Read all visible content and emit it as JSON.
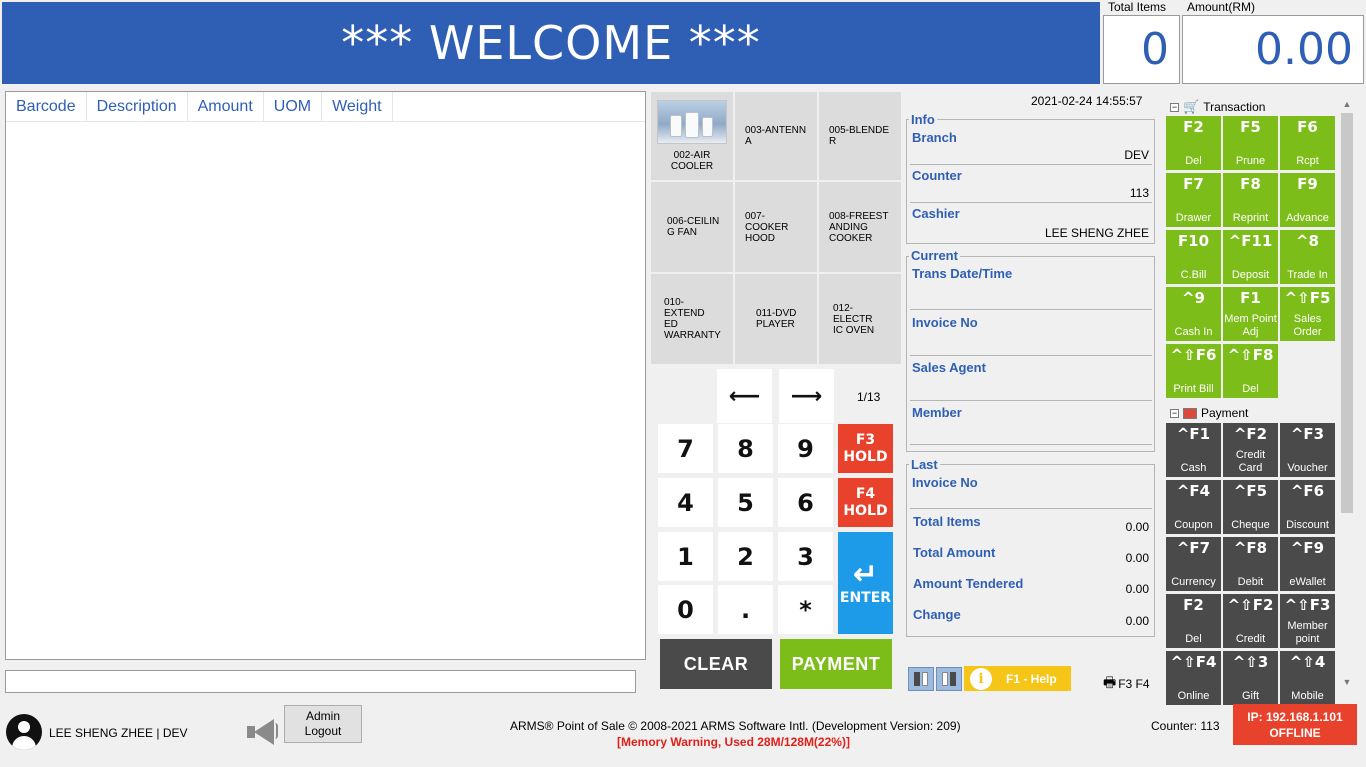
{
  "header": {
    "welcome": "*** WELCOME ***",
    "total_items_label": "Total Items",
    "total_items": "0",
    "amount_label": "Amount(RM)",
    "amount": "0.00"
  },
  "item_table": {
    "columns": [
      "Barcode",
      "Description",
      "Amount",
      "UOM",
      "Weight"
    ]
  },
  "products": [
    {
      "label": "002-AIR COOLER",
      "thumb_text": "Air Cooler"
    },
    {
      "label": "003-ANTENNA"
    },
    {
      "label": "005-BLENDER"
    },
    {
      "label": "006-CEILING FAN"
    },
    {
      "label": "007-COOKER HOOD"
    },
    {
      "label": "008-FREESTANDING COOKER"
    },
    {
      "label": "010-EXTENDED WARRANTY"
    },
    {
      "label": "011-DVD PLAYER"
    },
    {
      "label": "012-ELECTRIC OVEN"
    }
  ],
  "product_lines": [
    [
      "002-AIR",
      "COOLER"
    ],
    [
      "003-ANTENN",
      "A"
    ],
    [
      "005-BLENDE",
      "R"
    ],
    [
      "006-CEILIN",
      "G FAN"
    ],
    [
      "007-COOKER",
      "HOOD"
    ],
    [
      "008-FREEST",
      "ANDING",
      "COOKER"
    ],
    [
      "010-EXTEND",
      "ED",
      "WARRANTY"
    ],
    [
      "011-DVD",
      "PLAYER"
    ],
    [
      "012-ELECTR",
      "IC OVEN"
    ]
  ],
  "pager": {
    "prev": "⟵",
    "next": "⟶",
    "page": "1/13"
  },
  "keypad": {
    "k7": "7",
    "k8": "8",
    "k9": "9",
    "k4": "4",
    "k5": "5",
    "k6": "6",
    "k1": "1",
    "k2": "2",
    "k3": "3",
    "k0": "0",
    "kdot": ".",
    "kstar": "*",
    "f3hold": "F3\nHOLD",
    "f4hold": "F4\nHOLD",
    "f3hold_key": "F3",
    "f3hold_lbl": "HOLD",
    "f4hold_key": "F4",
    "f4hold_lbl": "HOLD",
    "enter_glyph": "↵",
    "enter": "ENTER",
    "clear": "CLEAR",
    "payment": "PAYMENT"
  },
  "info": {
    "datetime": "2021-02-24 14:55:57",
    "info_title": "Info",
    "branch_label": "Branch",
    "branch": "DEV",
    "counter_label": "Counter",
    "counter": "113",
    "cashier_label": "Cashier",
    "cashier": "LEE SHENG ZHEE",
    "current_title": "Current",
    "trans_label": "Trans Date/Time",
    "invoice_label": "Invoice No",
    "agent_label": "Sales Agent",
    "member_label": "Member",
    "last_title": "Last",
    "last_invoice_label": "Invoice No",
    "total_items_label": "Total Items",
    "total_items": "0.00",
    "total_amount_label": "Total Amount",
    "total_amount": "0.00",
    "tendered_label": "Amount Tendered",
    "tendered": "0.00",
    "change_label": "Change",
    "change": "0.00"
  },
  "bottom_tools": {
    "help": "F1 - Help",
    "print_keys": "F3 F4"
  },
  "transaction": {
    "title": "Transaction",
    "keys": [
      {
        "key": "F2",
        "label": "Del"
      },
      {
        "key": "F5",
        "label": "Prune"
      },
      {
        "key": "F6",
        "label": "Rcpt"
      },
      {
        "key": "F7",
        "label": "Drawer"
      },
      {
        "key": "F8",
        "label": "Reprint"
      },
      {
        "key": "F9",
        "label": "Advance"
      },
      {
        "key": "F10",
        "label": "C.Bill"
      },
      {
        "key": "^F11",
        "label": "Deposit"
      },
      {
        "key": "^8",
        "label": "Trade In"
      },
      {
        "key": "^9",
        "label": "Cash In"
      },
      {
        "key": "F1",
        "label": "Mem Point Adj"
      },
      {
        "key": "^⇧F5",
        "label": "Sales Order"
      },
      {
        "key": "^⇧F6",
        "label": "Print Bill"
      },
      {
        "key": "^⇧F8",
        "label": "Del"
      }
    ]
  },
  "payment": {
    "title": "Payment",
    "keys": [
      {
        "key": "^F1",
        "label": "Cash"
      },
      {
        "key": "^F2",
        "label": "Credit Card"
      },
      {
        "key": "^F3",
        "label": "Voucher"
      },
      {
        "key": "^F4",
        "label": "Coupon"
      },
      {
        "key": "^F5",
        "label": "Cheque"
      },
      {
        "key": "^F6",
        "label": "Discount"
      },
      {
        "key": "^F7",
        "label": "Currency"
      },
      {
        "key": "^F8",
        "label": "Debit"
      },
      {
        "key": "^F9",
        "label": "eWallet"
      },
      {
        "key": "F2",
        "label": "Del"
      },
      {
        "key": "^⇧F2",
        "label": "Credit"
      },
      {
        "key": "^⇧F3",
        "label": "Member point"
      },
      {
        "key": "^⇧F4",
        "label": "Online"
      },
      {
        "key": "^⇧3",
        "label": "Gift"
      },
      {
        "key": "^⇧4",
        "label": "Mobile"
      }
    ]
  },
  "footer": {
    "user": "LEE SHENG ZHEE",
    "sep": "|",
    "branch": "DEV",
    "admin_logout": "Admin\nLogout",
    "admin": "Admin",
    "logout": "Logout",
    "copyright": "ARMS® Point of Sale © 2008-2021 ARMS Software Intl. (Development Version: 209)",
    "memory": "[Memory Warning, Used 28M/128M(22%)]",
    "counter": "Counter: 113",
    "ip": "IP: 192.168.1.101",
    "status": "OFFLINE"
  },
  "colors": {
    "brand_blue": "#2f5fb5",
    "green": "#7dbd1a",
    "dark": "#4a4a4a",
    "red": "#e8412c",
    "enter_blue": "#1e9be8",
    "help_yellow": "#f5c518"
  }
}
